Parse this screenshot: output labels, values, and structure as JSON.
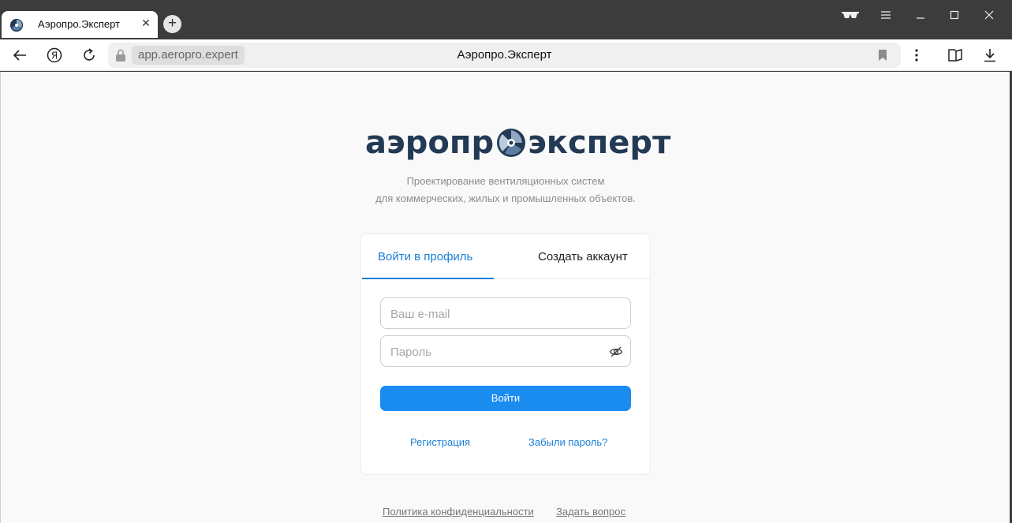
{
  "browser": {
    "tab_title": "Аэропро.Эксперт",
    "url": "app.aeropro.expert",
    "page_title": "Аэропро.Эксперт"
  },
  "logo": {
    "part1": "аэропр",
    "part2": "эксперт"
  },
  "tagline": {
    "line1": "Проектирование вентиляционных систем",
    "line2": "для коммерческих, жилых и промышленных объектов."
  },
  "auth": {
    "tab_login": "Войти в профиль",
    "tab_register": "Создать аккаунт",
    "email_placeholder": "Ваш e-mail",
    "password_placeholder": "Пароль",
    "submit": "Войти",
    "register_link": "Регистрация",
    "forgot_link": "Забыли пароль?"
  },
  "footer": {
    "privacy": "Политика конфиденциальности",
    "ask": "Задать вопрос"
  },
  "colors": {
    "accent": "#1a8cf0",
    "brand": "#233a55",
    "logo_accent": "#8fa8c4"
  }
}
